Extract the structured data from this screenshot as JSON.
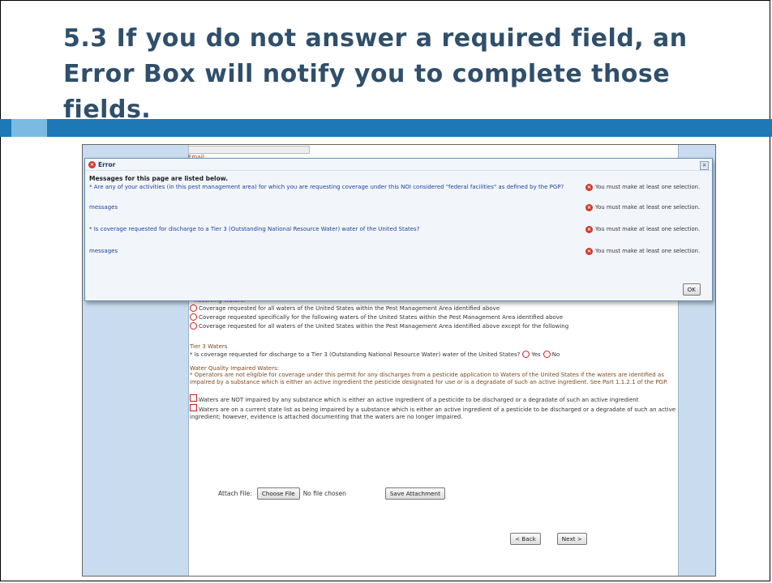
{
  "slide": {
    "title": "5.3 If you do not answer a required field, an Error Box will notify you to complete those fields."
  },
  "form": {
    "email_label": "Email:",
    "receiving_title": "* Receiving Waters:",
    "receiving_options": [
      "Coverage requested for all waters of the United States within the Pest Management Area identified above",
      "Coverage requested specifically for the following waters of the United States within the Pest Management Area identified above",
      "Coverage requested for all waters of the United States within the Pest Management Area identified above except for the following"
    ],
    "tier3_title": "Tier 3 Waters",
    "tier3_question": "* Is coverage requested for discharge to a Tier 3 (Outstanding National Resource Water) water of the United States?",
    "yes_label": "Yes",
    "no_label": "No",
    "wq_title": "Water Quality Impaired Waters:",
    "wq_note": "* Operators are not eligible for coverage under this permit for any discharges from a pesticide application to Waters of the United States if the waters are identified as impaired by a substance which is either an active ingredient the pesticide designated for use or is a degradate of such an active ingredient. See Part 1.1.2.1 of the PGP.",
    "wq_options": [
      "Waters are NOT impaired by any substance which is either an active ingredient of a pesticide to be discharged or a degradate of such an active ingredient",
      "Waters are on a current state list as being impaired by a substance which is either an active ingredient of a pesticide to be discharged or a degradate of such an active ingredient; however, evidence is attached documenting that the waters are no longer impaired."
    ],
    "attach_label": "Attach File:",
    "choose_file": "Choose File",
    "no_file": "No file chosen",
    "save_attachment": "Save Attachment",
    "back": "< Back",
    "next": "Next >"
  },
  "dialog": {
    "title": "Error",
    "subtitle": "Messages for this page are listed below.",
    "messages": [
      {
        "text": "* Are any of your activities (in this pest management area) for which you are requesting coverage under this NOI considered \"federal facilities\" as defined by the PGP?",
        "error": "You must make at least one selection."
      },
      {
        "text": "messages",
        "error": "You must make at least one selection."
      },
      {
        "text": "* Is coverage requested for discharge to a Tier 3 (Outstanding National Resource Water) water of the United States?",
        "error": "You must make at least one selection."
      },
      {
        "text": "messages",
        "error": "You must make at least one selection."
      }
    ],
    "ok": "OK",
    "close_glyph": "×"
  },
  "colors": {
    "title": "#2f4f6b",
    "accent_bar": "#1e78b6",
    "accent_square": "#7bbbe3",
    "error_red": "#cc1f1f"
  }
}
